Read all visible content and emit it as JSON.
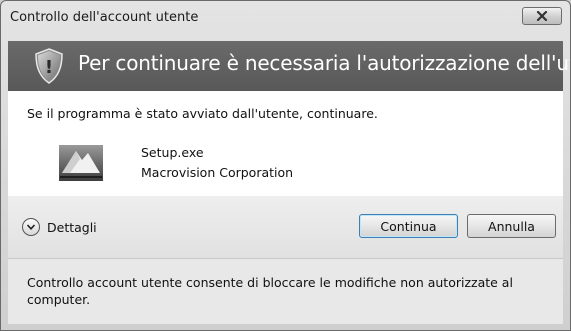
{
  "window": {
    "title": "Controllo dell'account utente",
    "banner": "Per continuare è necessaria l'autorizzazione dell'utente"
  },
  "content": {
    "instruction": "Se il programma è stato avviato dall'utente, continuare.",
    "program_name": "Setup.exe",
    "publisher": "Macrovision Corporation",
    "program_icon": "setup-installer-icon"
  },
  "actions": {
    "details_label": "Dettagli",
    "continue_label": "Continua",
    "cancel_label": "Annulla"
  },
  "footer": {
    "text": "Controllo account utente consente di bloccare le modifiche non autorizzate al computer."
  },
  "icons": {
    "close": "close-icon",
    "shield": "shield-icon",
    "details": "chevron-down-icon"
  }
}
